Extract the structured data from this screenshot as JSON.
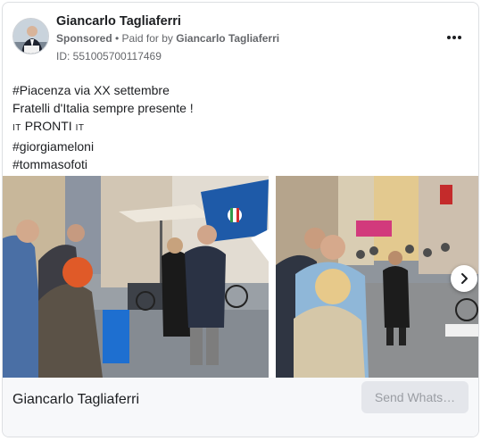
{
  "ad": {
    "advertiser_name": "Giancarlo Tagliaferri",
    "sponsored_label": "Sponsored",
    "separator": " • ",
    "paid_for_label": "Paid for by ",
    "paid_for_name": "Giancarlo Tagliaferri",
    "id_label": "ID: 551005700117469",
    "more_icon": "more-horizontal-icon",
    "body_lines": {
      "line1": "#Piacenza via XX settembre",
      "line2": "Fratelli d'Italia sempre presente !",
      "line3_flag_left": "IT",
      "line3_text": " PRONTI ",
      "line3_flag_right": "IT",
      "line4": "#giorgiameloni",
      "line5": "#tommasofoti"
    },
    "carousel": {
      "next_icon": "chevron-right-icon"
    },
    "footer": {
      "title": "Giancarlo Tagliaferri",
      "cta_label": "Send Whats…"
    }
  },
  "colors": {
    "text_primary": "#1c1e21",
    "text_secondary": "#65676b",
    "footer_bg": "#f7f8fa",
    "cta_bg": "#e4e6eb",
    "cta_text": "#9a9da3",
    "party_blue": "#1e5aa8"
  }
}
